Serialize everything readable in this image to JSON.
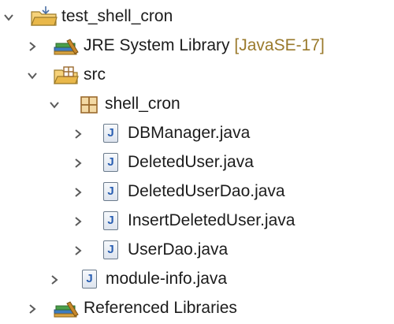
{
  "project": {
    "name": "test_shell_cron",
    "children": [
      {
        "label": "JRE System Library",
        "decoration": "[JavaSE-17]"
      },
      {
        "label": "src",
        "packages": [
          {
            "label": "shell_cron",
            "files": [
              "DBManager.java",
              "DeletedUser.java",
              "DeletedUserDao.java",
              "InsertDeletedUser.java",
              "UserDao.java"
            ]
          }
        ],
        "module_file": "module-info.java"
      },
      {
        "label": "Referenced Libraries"
      }
    ]
  },
  "icons": {
    "java_file": "J",
    "colors": {
      "folder": "#e4b94a",
      "library": "#5a7fa8",
      "package": "#9b6a2e",
      "decoration": "#9a7a2c"
    }
  }
}
